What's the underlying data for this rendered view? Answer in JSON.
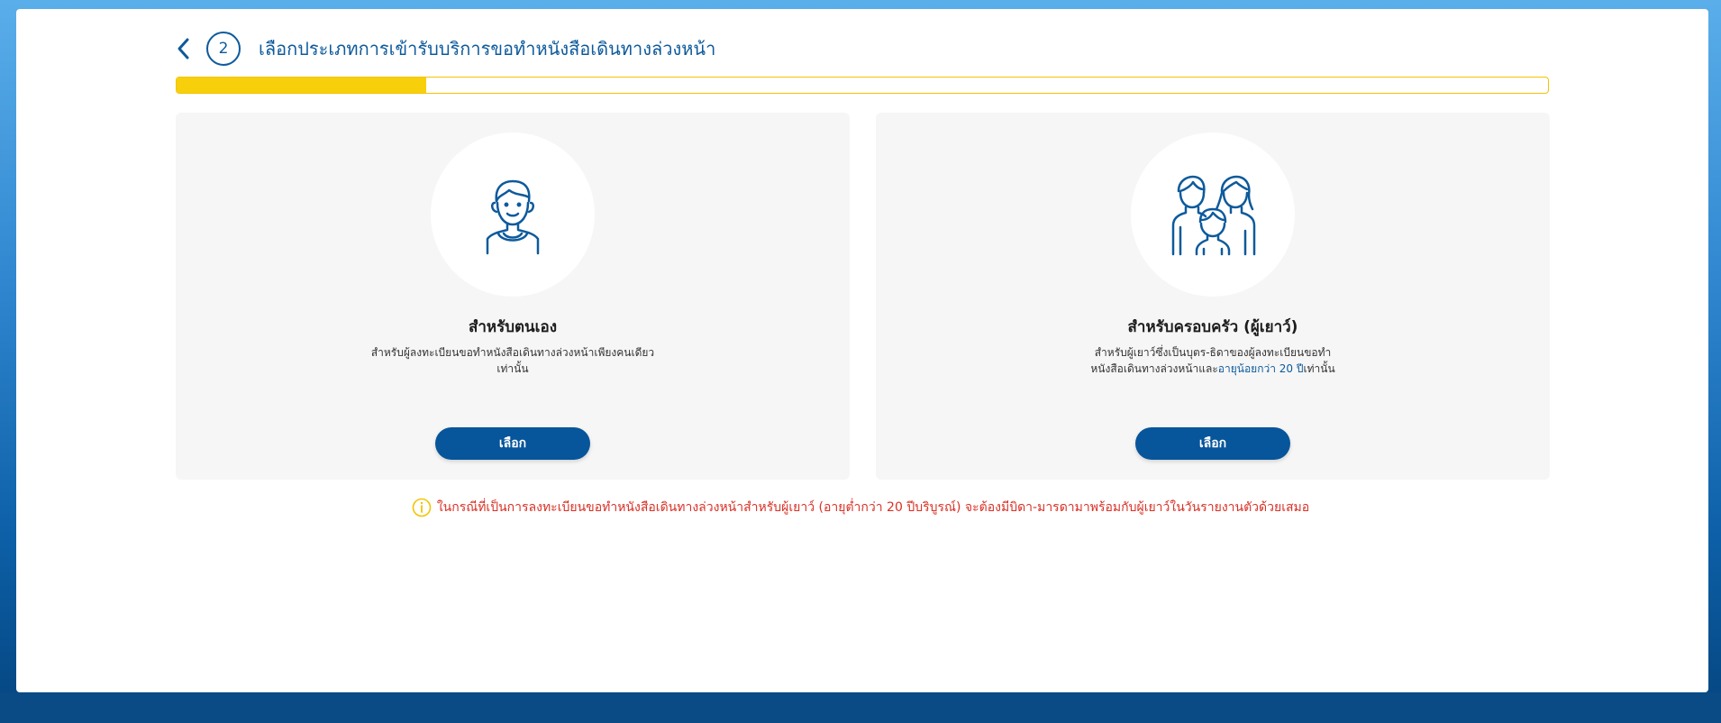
{
  "header": {
    "step_number": "2",
    "title": "เลือกประเภทการเข้ารับบริการขอทำหนังสือเดินทางล่วงหน้า"
  },
  "progress": {
    "fraction": 0.182
  },
  "cards": [
    {
      "icon": "person-icon",
      "title": "สำหรับตนเอง",
      "desc": "สำหรับผู้ลงทะเบียนขอทำหนังสือเดินทางล่วงหน้าเพียงคนเดียวเท่านั้น",
      "button_label": "เลือก"
    },
    {
      "icon": "family-icon",
      "title": "สำหรับครอบครัว (ผู้เยาว์)",
      "desc_prefix": "สำหรับผู้เยาว์ซึ่งเป็นบุตร-ธิดาของผู้ลงทะเบียนขอทำหนังสือเดินทางล่วงหน้าและ",
      "desc_highlight": "อายุน้อยกว่า 20 ปี",
      "desc_suffix": "เท่านั้น",
      "button_label": "เลือก"
    }
  ],
  "notice": {
    "icon": "info-icon",
    "text": "ในกรณีที่เป็นการลงทะเบียนขอทำหนังสือเดินทางล่วงหน้าสำหรับผู้เยาว์ (อายุต่ำกว่า 20 ปีบริบูรณ์) จะต้องมีบิดา-มารดามาพร้อมกับผู้เยาว์ในวันรายงานตัวด้วยเสมอ"
  },
  "colors": {
    "primary": "#07559b",
    "accent_yellow": "#f7cf0a",
    "warning_red": "#d93025",
    "card_bg": "#f6f6f6"
  }
}
